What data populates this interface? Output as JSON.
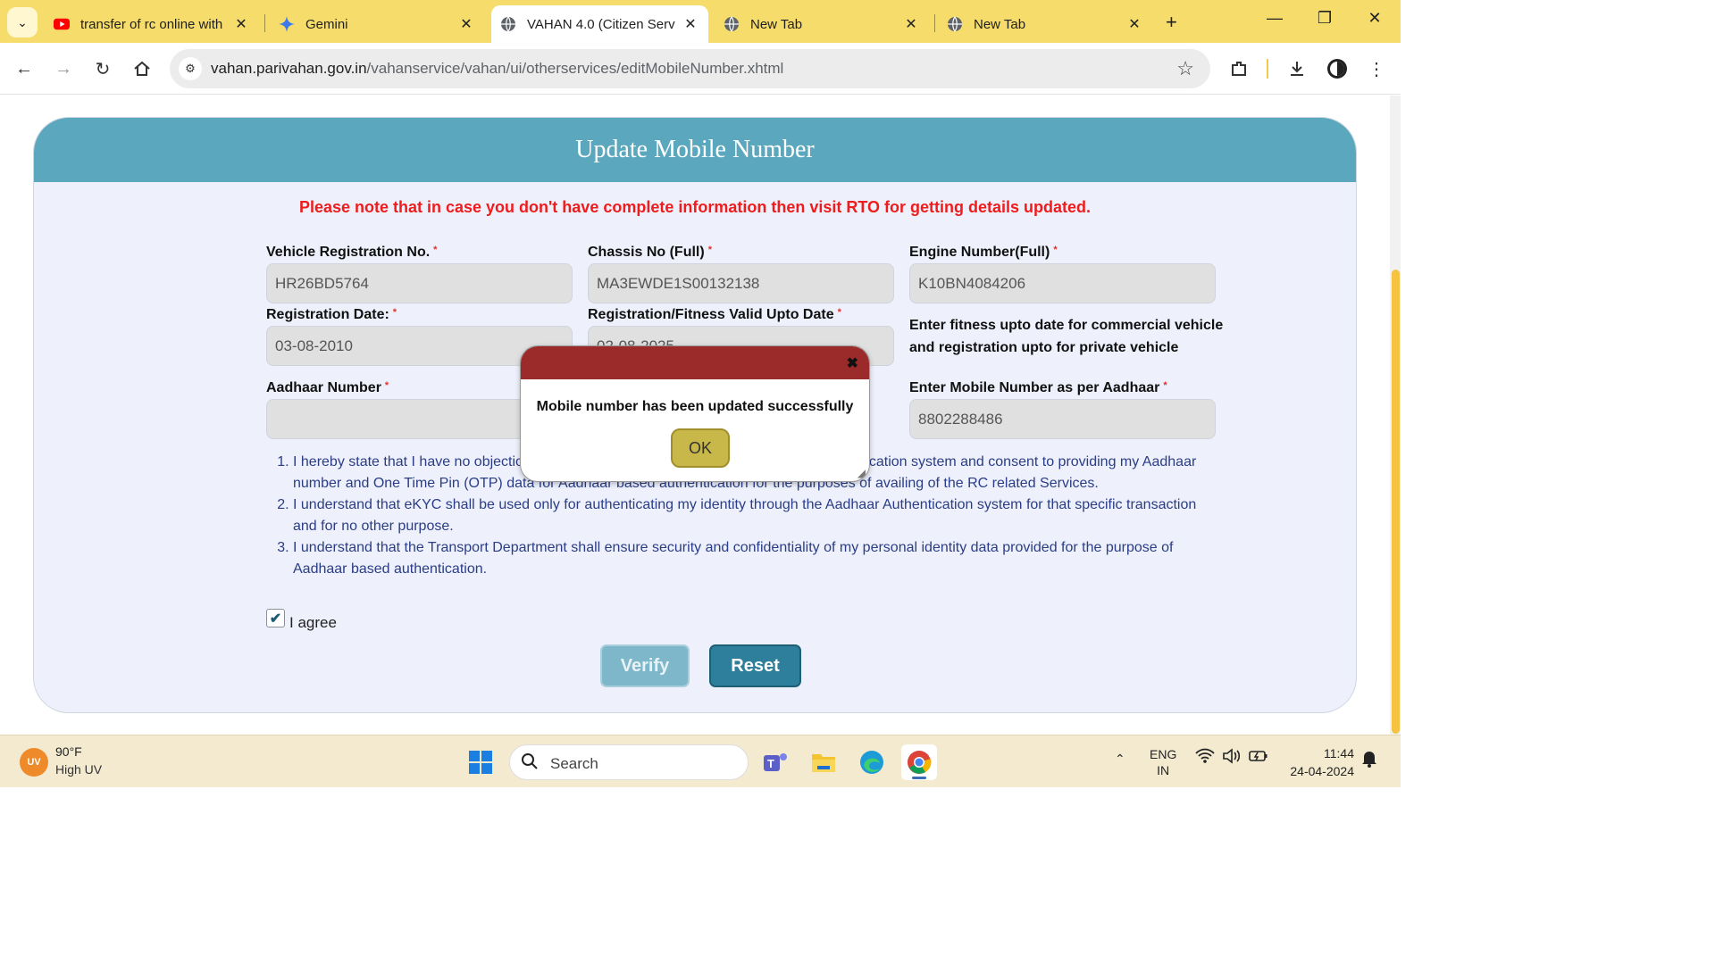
{
  "browser": {
    "tabs": [
      {
        "title": "transfer of rc online with",
        "icon": "youtube-icon",
        "active": false
      },
      {
        "title": "Gemini",
        "icon": "gemini-icon",
        "active": false
      },
      {
        "title": "VAHAN 4.0 (Citizen Serv",
        "icon": "globe-icon",
        "active": true
      },
      {
        "title": "New Tab",
        "icon": "globe-icon",
        "active": false
      },
      {
        "title": "New Tab",
        "icon": "globe-icon",
        "active": false
      }
    ],
    "url_host": "vahan.parivahan.gov.in",
    "url_path": "/vahanservice/vahan/ui/otherservices/editMobileNumber.xhtml"
  },
  "form": {
    "title": "Update Mobile Number",
    "notice": "Please note that in case you don't have complete information then visit RTO for getting details updated.",
    "fields": {
      "vehicle_reg": {
        "label": "Vehicle Registration No.",
        "value": "HR26BD5764"
      },
      "chassis": {
        "label": "Chassis No (Full)",
        "value": "MA3EWDE1S00132138"
      },
      "engine": {
        "label": "Engine Number(Full)",
        "value": "K10BN4084206"
      },
      "reg_date": {
        "label": "Registration Date:",
        "value": "03-08-2010"
      },
      "valid_upto": {
        "label": "Registration/Fitness Valid Upto Date",
        "value": "02-08-2025"
      },
      "aadhaar": {
        "label": "Aadhaar Number",
        "value": ""
      },
      "mobile": {
        "label": "Enter Mobile Number as per Aadhaar",
        "value": "8802288486"
      }
    },
    "required_mark": "*",
    "hint": "Enter fitness upto date for commercial vehicle and registration upto for private vehicle",
    "declarations": [
      "I hereby state that I have no objection in authenticating myself with Aadhaar based authentication system and consent to providing my Aadhaar number and One Time Pin (OTP) data for Aadhaar based authentication for the purposes of availing of the RC related Services.",
      "I understand that eKYC shall be used only for authenticating my identity through the Aadhaar Authentication system for that specific transaction and for no other purpose.",
      "I understand that the Transport Department shall ensure security and confidentiality of my personal identity data provided for the purpose of Aadhaar based authentication."
    ],
    "agree_label": "I agree",
    "agree_checked": true,
    "verify_label": "Verify",
    "reset_label": "Reset"
  },
  "dialog": {
    "message": "Mobile number has been updated successfully",
    "ok_label": "OK",
    "close_glyph": "✖",
    "header_color": "#9b2a2b"
  },
  "taskbar": {
    "weather_badge": "UV",
    "weather_temp": "90°F",
    "weather_desc": "High UV",
    "search_placeholder": "Search",
    "lang_line1": "ENG",
    "lang_line2": "IN",
    "time": "11:44",
    "date": "24-04-2024"
  },
  "colors": {
    "tabbar": "#f6dc6a",
    "panel_header": "#5ba7bd",
    "notice": "#ee1c1c",
    "declaration_text": "#2a3d86",
    "reset_button": "#2d7f9b",
    "ok_button": "#c8b84a"
  }
}
